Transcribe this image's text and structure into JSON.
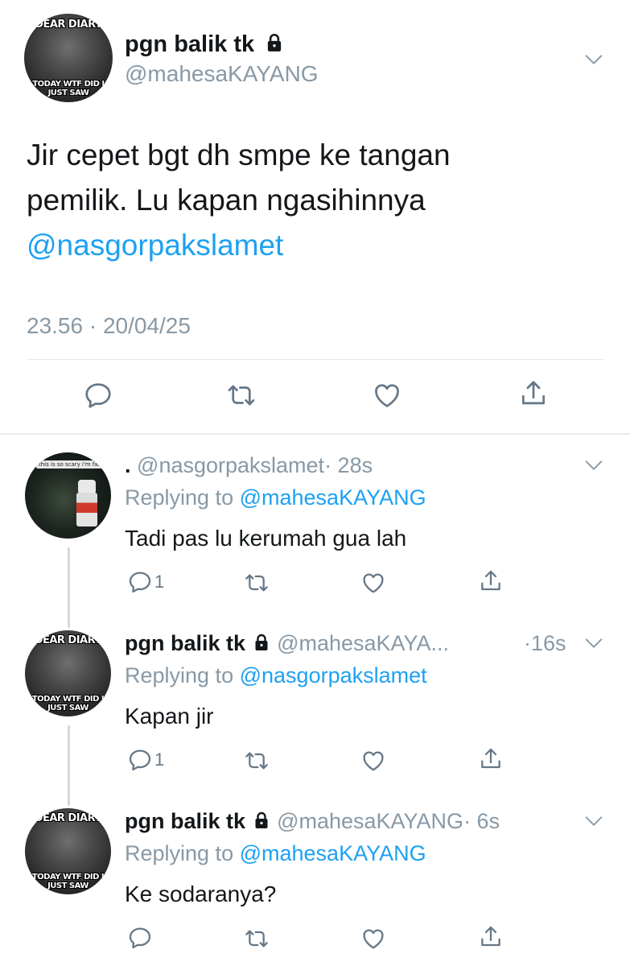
{
  "main_tweet": {
    "display_name": "pgn balik tk",
    "handle": "@mahesaKAYANG",
    "text_line1": "Jir cepet bgt dh smpe ke tangan",
    "text_line2": "pemilik. Lu kapan ngasihinnya",
    "mention": "@nasgorpakslamet",
    "timestamp": "23.56 · 20/04/25",
    "avatar_top_text": "DEAR DIARY",
    "avatar_bottom_text": "TODAY WTF DID I JUST SAW"
  },
  "replies": [
    {
      "display_name": ".",
      "handle": "@nasgorpakslamet",
      "time": "· 28s",
      "replying_label": "Replying to",
      "replying_to": "@mahesaKAYANG",
      "text": "Tadi pas lu kerumah gua lah",
      "reply_count": "1",
      "avatar_caption": "this is so scary i'm farting"
    },
    {
      "display_name": "pgn balik tk",
      "handle": "@mahesaKAYA...",
      "time": "·16s",
      "replying_label": "Replying to",
      "replying_to": "@nasgorpakslamet",
      "text": "Kapan jir",
      "reply_count": "1"
    },
    {
      "display_name": "pgn balik tk",
      "handle": "@mahesaKAYANG",
      "time": "· 6s",
      "replying_label": "Replying to",
      "replying_to": "@mahesaKAYANG",
      "text": "Ke sodaranya?",
      "reply_count": ""
    }
  ],
  "colors": {
    "link": "#1da1f2",
    "muted": "#8899a6",
    "icon": "#657786",
    "divider": "#e1e8ed"
  },
  "icons": [
    "lock-icon",
    "chevron-down-icon",
    "reply-icon",
    "retweet-icon",
    "like-icon",
    "share-icon"
  ]
}
